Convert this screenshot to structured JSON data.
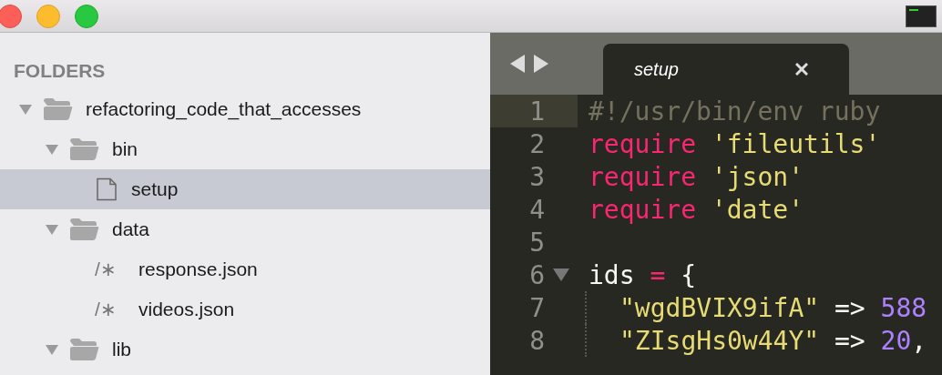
{
  "sidebar": {
    "heading": "FOLDERS",
    "tree": [
      {
        "kind": "folder",
        "name": "refactoring_code_that_accesses",
        "expanded": true,
        "selected": false,
        "children": [
          {
            "kind": "folder",
            "name": "bin",
            "expanded": true,
            "selected": false,
            "children": [
              {
                "kind": "file",
                "name": "setup",
                "selected": true
              }
            ]
          },
          {
            "kind": "folder",
            "name": "data",
            "expanded": true,
            "selected": false,
            "children": [
              {
                "kind": "code",
                "glyph": "/∗",
                "name": "response.json",
                "selected": false
              },
              {
                "kind": "code",
                "glyph": "/∗",
                "name": "videos.json",
                "selected": false
              }
            ]
          },
          {
            "kind": "folder",
            "name": "lib",
            "expanded": true,
            "selected": false
          }
        ]
      }
    ]
  },
  "tabs": [
    {
      "label": "setup",
      "selected": true
    }
  ],
  "editor": {
    "lines": [
      {
        "number": "1",
        "current": true,
        "tokens": [
          {
            "kind": "comment",
            "text": "#!/usr/bin/env ruby"
          }
        ]
      },
      {
        "number": "2",
        "current": false,
        "tokens": [
          {
            "kind": "keyword",
            "text": "require"
          },
          {
            "kind": "string",
            "text": " 'fileutils'"
          }
        ]
      },
      {
        "number": "3",
        "current": false,
        "tokens": [
          {
            "kind": "keyword",
            "text": "require"
          },
          {
            "kind": "string",
            "text": " 'json'"
          }
        ]
      },
      {
        "number": "4",
        "current": false,
        "tokens": [
          {
            "kind": "keyword",
            "text": "require"
          },
          {
            "kind": "string",
            "text": " 'date'"
          }
        ]
      },
      {
        "number": "5",
        "current": false
      },
      {
        "number": "6",
        "current": false,
        "foldable": true,
        "tokens": [
          {
            "kind": "plain",
            "text": "ids "
          },
          {
            "kind": "keyword",
            "text": "="
          },
          {
            "kind": "plain",
            "text": " {"
          }
        ]
      },
      {
        "number": "7",
        "current": false,
        "indented": true,
        "tokens": [
          {
            "kind": "string",
            "text": "\"wgdBVIX9ifA\""
          },
          {
            "kind": "plain",
            "text": " => "
          },
          {
            "kind": "number",
            "text": "588"
          }
        ]
      },
      {
        "number": "8",
        "current": false,
        "indented": true,
        "tokens": [
          {
            "kind": "string",
            "text": "\"ZIsgHs0w44Y\""
          },
          {
            "kind": "plain",
            "text": " => "
          },
          {
            "kind": "number",
            "text": "20"
          },
          {
            "kind": "plain",
            "text": ","
          }
        ]
      }
    ]
  }
}
